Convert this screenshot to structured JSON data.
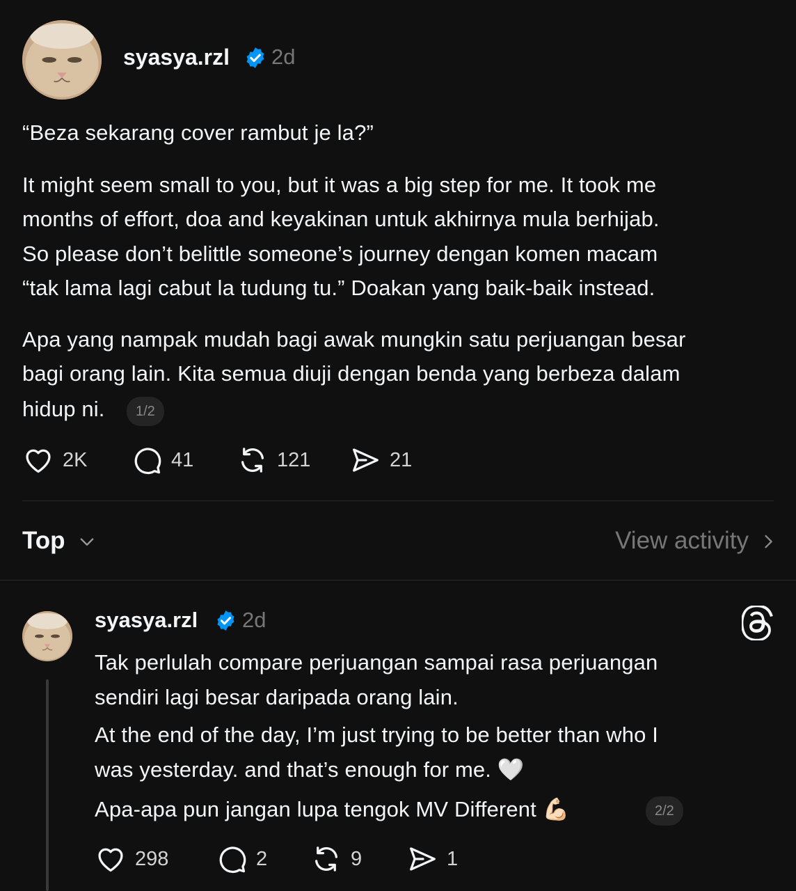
{
  "post": {
    "username": "syasya.rzl",
    "time": "2d",
    "lines": [
      "“Beza sekarang cover rambut je la?”",
      "It might seem small to you, but it was a big step for me. It took me",
      "months of effort, doa and keyakinan untuk akhirnya mula berhijab.",
      "So please don’t belittle someone’s journey dengan komen macam",
      "“tak lama lagi cabut la tudung tu.” Doakan yang baik-baik instead.",
      "Apa yang nampak mudah bagi awak mungkin satu perjuangan besar",
      "bagi orang lain. Kita semua diuji dengan benda yang berbeza dalam",
      "hidup ni."
    ],
    "page_indicator": "1/2",
    "actions": {
      "likes": "2K",
      "comments": "41",
      "reposts": "121",
      "shares": "21"
    }
  },
  "replies_header": {
    "sort": "Top",
    "view_activity": "View activity"
  },
  "reply": {
    "username": "syasya.rzl",
    "time": "2d",
    "lines": [
      "Tak perlulah compare perjuangan sampai rasa perjuangan",
      "sendiri lagi besar daripada orang lain.",
      "At the end of the day, I’m just trying to be better than who I",
      "was yesterday. and that’s enough for me. 🤍",
      "Apa-apa pun jangan lupa tengok MV Different 💪🏻"
    ],
    "page_indicator": "2/2",
    "actions": {
      "likes": "298",
      "comments": "2",
      "reposts": "9",
      "shares": "1"
    }
  },
  "colors": {
    "background": "#101010",
    "text": "#f3f5f7",
    "muted": "#777777",
    "verified": "#0095f6",
    "divider": "#2b2b2b"
  },
  "icons": [
    "verified-badge-icon",
    "heart-icon",
    "comment-icon",
    "repost-icon",
    "share-icon",
    "chevron-down-icon",
    "chevron-right-icon",
    "threads-logo-icon"
  ]
}
